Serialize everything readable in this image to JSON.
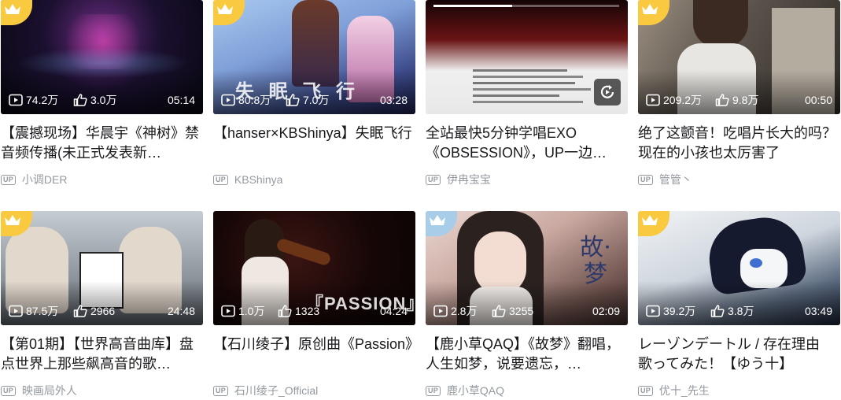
{
  "colors": {
    "vip_gold": "#f9c940",
    "vip_blue": "#a8cde8",
    "title": "#18191c",
    "meta": "#9499a0"
  },
  "cards": [
    {
      "title": "【震撼现场】华晨宇《神树》禁音频传播(未正式发表新…",
      "uploader": "小调DER",
      "plays": "74.2万",
      "likes": "3.0万",
      "duration": "05:14",
      "badge": "crown-gold"
    },
    {
      "title": "【hanser×KBShinya】失眠飞行",
      "uploader": "KBShinya",
      "plays": "80.8万",
      "likes": "7.0万",
      "duration": "03:28",
      "badge": "crown-gold",
      "thumb_text": "失 眠 飞 行"
    },
    {
      "title": "全站最快5分钟学唱EXO《OBSESSION》，UP一边…",
      "uploader": "伊冉宝宝",
      "badge": "none"
    },
    {
      "title": "绝了这颤音！吃唱片长大的吗？现在的小孩也太厉害了",
      "uploader": "管管丶",
      "plays": "209.2万",
      "likes": "9.8万",
      "duration": "00:50",
      "badge": "crown-gold"
    },
    {
      "title": "【第01期】【世界高音曲库】盘点世界上那些飙高音的歌…",
      "uploader": "映画局外人",
      "plays": "87.5万",
      "likes": "2966",
      "duration": "24:48",
      "badge": "crown-gold"
    },
    {
      "title": "【石川绫子】原创曲《Passion》",
      "uploader": "石川绫子_Official",
      "plays": "1.0万",
      "likes": "1323",
      "duration": "04:24",
      "badge": "none",
      "thumb_text": "『PASSION』"
    },
    {
      "title": "【鹿小草QAQ】《故梦》翻唱，人生如梦，说要遗忘，…",
      "uploader": "鹿小草QAQ",
      "plays": "2.8万",
      "likes": "3255",
      "duration": "02:09",
      "badge": "crown-blue",
      "thumb_text": "故·梦"
    },
    {
      "title": "レーゾンデートル / 存在理由　歌ってみた！【ゆう十】",
      "uploader": "优十_先生",
      "plays": "39.2万",
      "likes": "3.8万",
      "duration": "03:49",
      "badge": "crown-gold"
    }
  ],
  "up_tag": "UP"
}
